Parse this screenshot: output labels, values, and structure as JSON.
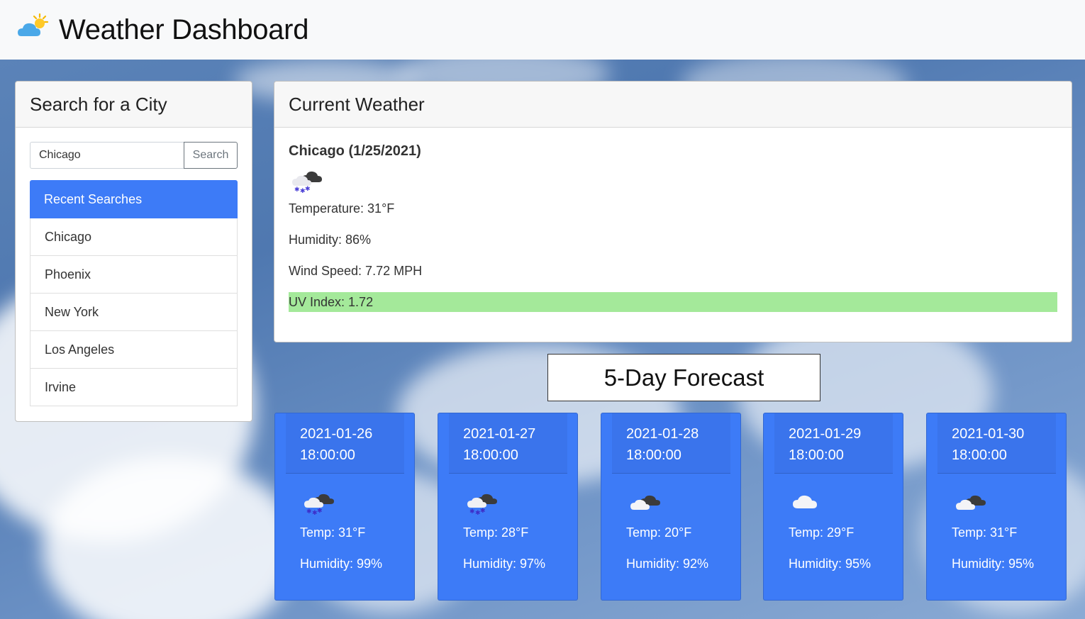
{
  "header": {
    "title": "Weather Dashboard"
  },
  "search": {
    "title": "Search for a City",
    "input_value": "Chicago",
    "button_label": "Search",
    "recent_label": "Recent Searches",
    "recent": [
      "Chicago",
      "Phoenix",
      "New York",
      "Los Angeles",
      "Irvine"
    ]
  },
  "current": {
    "title": "Current Weather",
    "city_date": "Chicago (1/25/2021)",
    "icon": "snow-cloud-icon",
    "temperature": "Temperature: 31°F",
    "humidity": "Humidity: 86%",
    "wind": "Wind Speed: 7.72 MPH",
    "uv": "UV Index: 1.72",
    "uv_color": "#a4e99a"
  },
  "forecast": {
    "title": "5-Day Forecast",
    "accent": "#3d7bf7",
    "days": [
      {
        "date": "2021-01-26",
        "time": "18:00:00",
        "icon": "snow-cloud-icon",
        "temp": "Temp: 31°F",
        "humidity": "Humidity: 99%"
      },
      {
        "date": "2021-01-27",
        "time": "18:00:00",
        "icon": "snow-cloud-icon",
        "temp": "Temp: 28°F",
        "humidity": "Humidity: 97%"
      },
      {
        "date": "2021-01-28",
        "time": "18:00:00",
        "icon": "broken-clouds-icon",
        "temp": "Temp: 20°F",
        "humidity": "Humidity: 92%"
      },
      {
        "date": "2021-01-29",
        "time": "18:00:00",
        "icon": "cloud-icon",
        "temp": "Temp: 29°F",
        "humidity": "Humidity: 95%"
      },
      {
        "date": "2021-01-30",
        "time": "18:00:00",
        "icon": "broken-clouds-icon",
        "temp": "Temp: 31°F",
        "humidity": "Humidity: 95%"
      }
    ]
  }
}
